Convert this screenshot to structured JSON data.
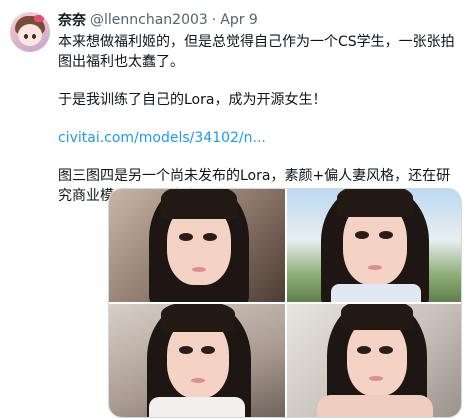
{
  "tweet": {
    "author_name": "奈奈",
    "handle": "@llennchan2003",
    "separator": "·",
    "date": "Apr 9",
    "paragraphs": [
      "本来想做福利姬的，但是总觉得自己作为一个CS学生，一张张拍图出福利也太蠢了。",
      "于是我训练了自己的Lora，成为开源女生！",
      "civitai.com/models/34102/n...",
      "图三图四是另一个尚未发布的Lora，素颜+偏人妻风格，还在研究商业模式，不想白发布出来（"
    ]
  },
  "colors": {
    "text": "#0f1419",
    "secondary": "#536471",
    "link": "#1d9bf0",
    "border": "#cfd9de"
  },
  "media": {
    "images": [
      {
        "name": "photo-1",
        "scene": "indoor-warm"
      },
      {
        "name": "photo-2",
        "scene": "outdoor-sunny"
      },
      {
        "name": "photo-3",
        "scene": "indoor-white-top"
      },
      {
        "name": "photo-4",
        "scene": "indoor-bare-shoulders"
      }
    ]
  }
}
